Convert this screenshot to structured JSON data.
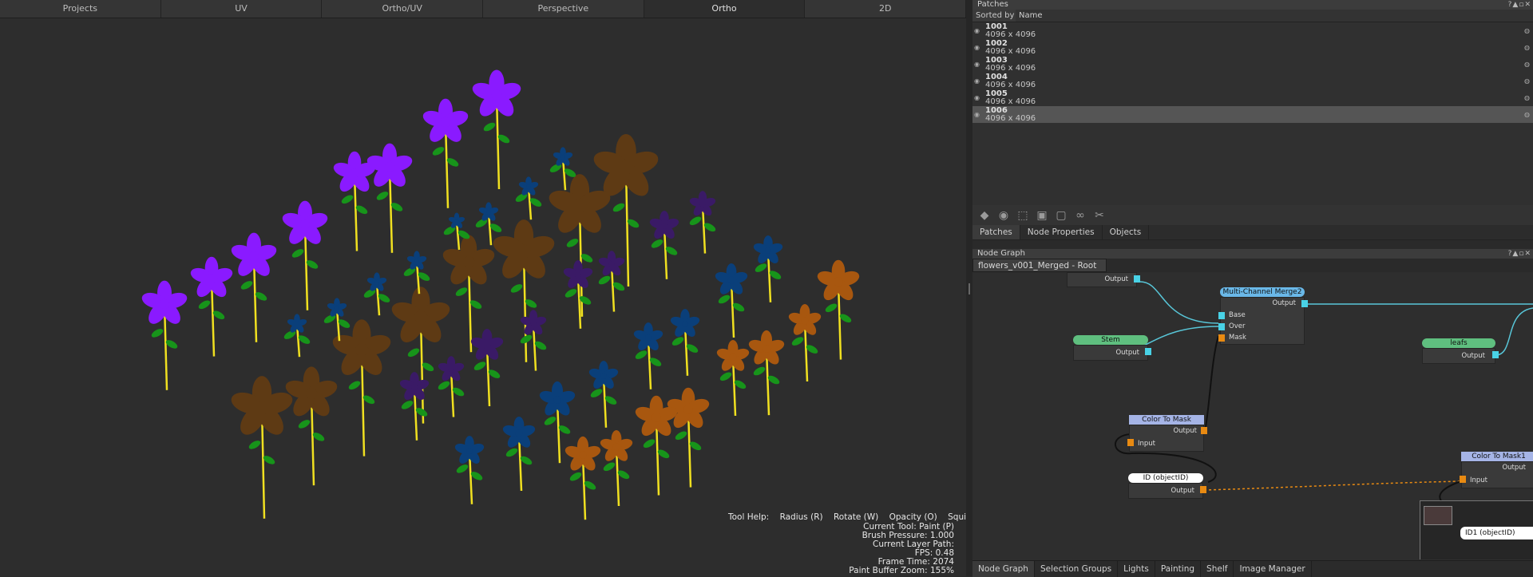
{
  "viewport_tabs": [
    "Projects",
    "UV",
    "Ortho/UV",
    "Perspective",
    "Ortho",
    "2D"
  ],
  "active_viewport_tab": 4,
  "tool_help": {
    "label": "Tool Help:",
    "radius": "Radius (R)",
    "rotate": "Rotate (W)",
    "opacity": "Opacity (O)",
    "squish": "Squish (Q)"
  },
  "status": {
    "current_tool": "Current Tool: Paint (P)",
    "brush_pressure": "Brush Pressure: 1.000",
    "layer_path": "Current Layer Path:",
    "fps": "FPS: 0.48",
    "frame_time": "Frame Time: 2074",
    "buffer_zoom": "Paint Buffer Zoom: 155%"
  },
  "patches_panel": {
    "title": "Patches",
    "sorted_by_label": "Sorted by",
    "sorted_by_value": "Name",
    "items": [
      {
        "num": "1001",
        "res": "4096 x 4096"
      },
      {
        "num": "1002",
        "res": "4096 x 4096"
      },
      {
        "num": "1003",
        "res": "4096 x 4096"
      },
      {
        "num": "1004",
        "res": "4096 x 4096"
      },
      {
        "num": "1005",
        "res": "4096 x 4096"
      },
      {
        "num": "1006",
        "res": "4096 x 4096"
      }
    ],
    "selected": 5
  },
  "sub_tabs": [
    "Patches",
    "Node Properties",
    "Objects"
  ],
  "node_graph": {
    "title": "Node Graph",
    "breadcrumb": "flowers_v001_Merged - Root",
    "nodes": {
      "top_output": "Output",
      "merge": {
        "name": "Multi-Channel Merge2",
        "output": "Output",
        "base": "Base",
        "over": "Over",
        "mask": "Mask"
      },
      "stem": {
        "name": "Stem",
        "output": "Output"
      },
      "leafs": {
        "name": "leafs",
        "output": "Output"
      },
      "ctm": {
        "name": "Color To Mask",
        "output": "Output",
        "input": "Input"
      },
      "ctm1": {
        "name": "Color To Mask1",
        "output": "Output",
        "input": "Input"
      },
      "id": {
        "name": "ID (objectID)",
        "output": "Output"
      },
      "id1": {
        "name": "ID1 (objectID)"
      }
    }
  },
  "bottom_tabs": [
    "Node Graph",
    "Selection Groups",
    "Lights",
    "Painting",
    "Shelf",
    "Image Manager"
  ],
  "colors": {
    "purple_flower": "#8a1aff",
    "dark_purple_flower": "#3a1a66",
    "blue_flower": "#0a3f7a",
    "brown_flower": "#5e3a14",
    "orange_flower": "#a8570f",
    "stem": "#f0e020",
    "leaf": "#17941a",
    "node_green": "#5fbf7f",
    "node_blue": "#6ab8e8",
    "node_lavender": "#a5b4e6",
    "port_cyan": "#49d2e6",
    "port_orange": "#e88a12"
  }
}
